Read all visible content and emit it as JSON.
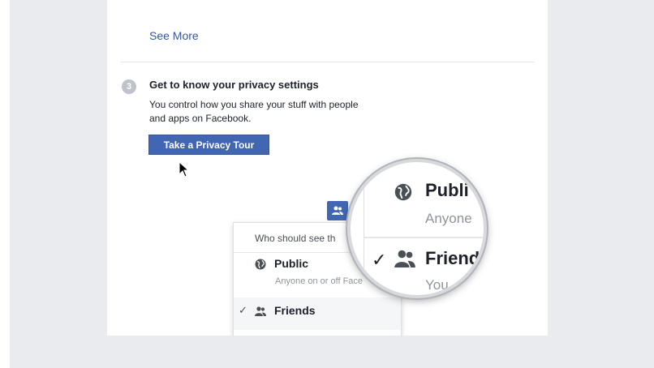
{
  "colors": {
    "page_background": "#e9ebee",
    "card_background": "#ffffff",
    "link": "#365899",
    "button_blue": "#4267b2",
    "text_dark": "#1d2129",
    "text_muted": "#90949c"
  },
  "feed": {
    "see_more": "See More"
  },
  "step": {
    "number": "3",
    "title": "Get to know your privacy settings",
    "description": "You control how you share your stuff with people and apps on Facebook.",
    "button_label": "Take a Privacy Tour"
  },
  "audience_menu": {
    "header": "Who should see th",
    "items": [
      {
        "label": "Public",
        "sublabel": "Anyone on or off Face",
        "icon": "globe-icon",
        "checked": false
      },
      {
        "label": "Friends",
        "icon": "friends-icon",
        "checked": true
      }
    ],
    "check_glyph": "✓"
  },
  "magnifier": {
    "public_label": "Publi",
    "public_sublabel": "Anyone",
    "friends_label": "Friend",
    "friends_sublabel": "You",
    "check_glyph": "✓"
  }
}
